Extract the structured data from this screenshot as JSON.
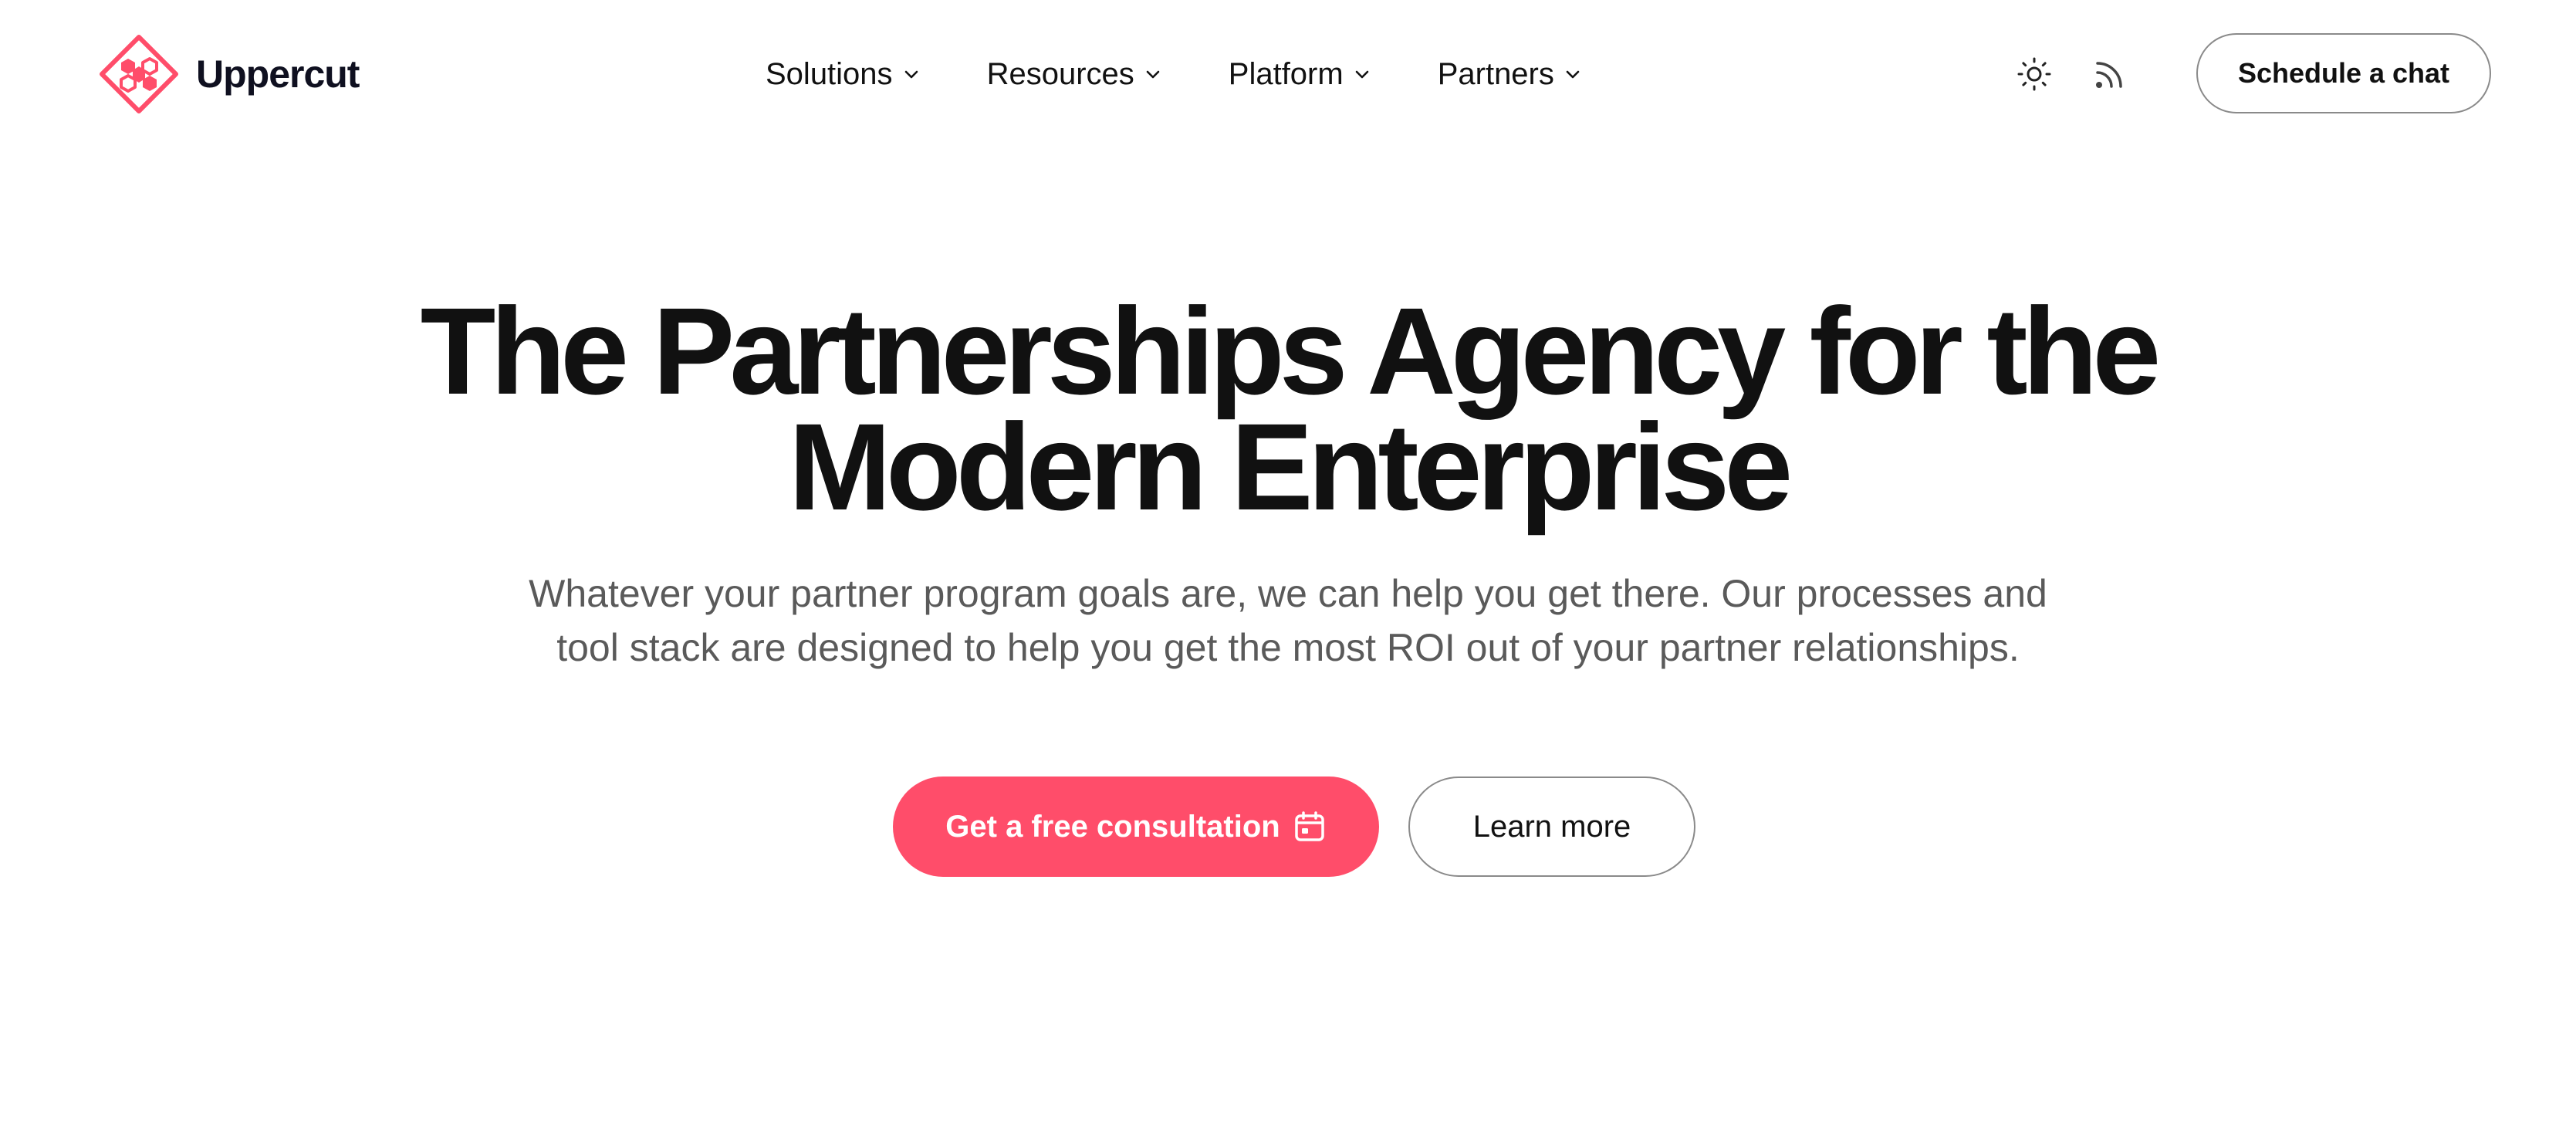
{
  "brand": {
    "name": "Uppercut",
    "logo_icon": "hexagon-diamond-logo",
    "accent_color": "#ff4d6a"
  },
  "nav": {
    "items": [
      {
        "label": "Solutions",
        "icon": "chevron-down-icon"
      },
      {
        "label": "Resources",
        "icon": "chevron-down-icon"
      },
      {
        "label": "Platform",
        "icon": "chevron-down-icon"
      },
      {
        "label": "Partners",
        "icon": "chevron-down-icon"
      }
    ]
  },
  "header_actions": {
    "theme_icon": "sun-icon",
    "feed_icon": "rss-icon",
    "schedule_label": "Schedule a chat"
  },
  "hero": {
    "title_line1": "The Partnerships Agency for the",
    "title_line2": "Modern Enterprise",
    "subtitle": "Whatever your partner program goals are, we can help you get there. Our processes and tool stack are designed to help you get the most ROI out of your partner relationships.",
    "primary_cta": "Get a free consultation",
    "primary_cta_icon": "calendar-icon",
    "secondary_cta": "Learn more"
  }
}
